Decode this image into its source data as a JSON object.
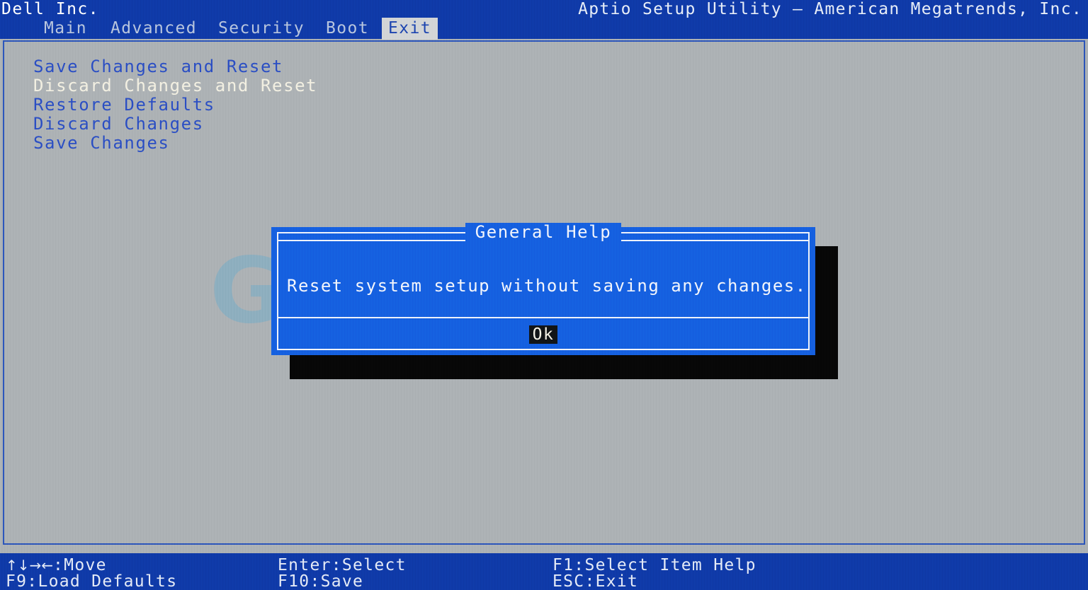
{
  "header": {
    "vendor": "Dell Inc.",
    "utility": "Aptio Setup Utility – American Megatrends, Inc."
  },
  "tabs": [
    {
      "label": "Main",
      "active": false
    },
    {
      "label": "Advanced",
      "active": false
    },
    {
      "label": "Security",
      "active": false
    },
    {
      "label": "Boot",
      "active": false
    },
    {
      "label": "Exit",
      "active": true
    }
  ],
  "menu": {
    "items": [
      {
        "label": "Save Changes and Reset",
        "selected": false
      },
      {
        "label": "Discard Changes and Reset",
        "selected": true
      },
      {
        "label": "Restore Defaults",
        "selected": false
      },
      {
        "label": "Discard Changes",
        "selected": false
      },
      {
        "label": "Save Changes",
        "selected": false
      }
    ]
  },
  "dialog": {
    "title": "General Help",
    "message": "Reset system setup without saving any changes.",
    "ok_label": "Ok"
  },
  "watermark": {
    "text": "GINUK.RU"
  },
  "statusbar": {
    "move_keys": "↑↓→←",
    "move_label": ":Move",
    "enter": "Enter:Select",
    "f1": "F1:Select Item Help",
    "f9": "F9:Load Defaults",
    "f10": "F10:Save",
    "esc": "ESC:Exit"
  },
  "colors": {
    "header_blue": "#0f3aa8",
    "dialog_blue": "#1560e0",
    "page_gray": "#adb2b5",
    "menu_blue": "#2b4fc4",
    "selected_text": "#f3f0e2",
    "tab_active_bg": "#d2d5d6",
    "shadow_black": "#070707",
    "watermark_blue": "#68aacd"
  }
}
